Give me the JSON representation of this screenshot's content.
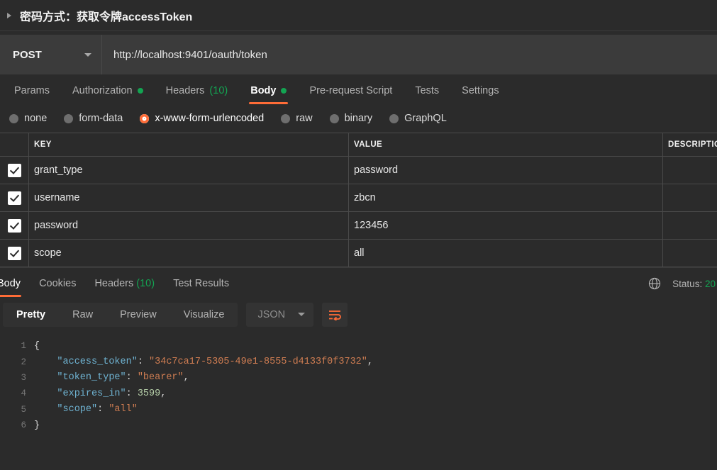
{
  "request": {
    "title": "密码方式：获取令牌accessToken",
    "method": "POST",
    "url": "http://localhost:9401/oauth/token",
    "tabs": [
      {
        "label": "Params",
        "badge": "",
        "badge_type": "none",
        "active": false
      },
      {
        "label": "Authorization",
        "badge": "",
        "badge_type": "dot",
        "active": false
      },
      {
        "label": "Headers",
        "badge": "(10)",
        "badge_type": "count",
        "active": false
      },
      {
        "label": "Body",
        "badge": "",
        "badge_type": "dot",
        "active": true
      },
      {
        "label": "Pre-request Script",
        "badge": "",
        "badge_type": "none",
        "active": false
      },
      {
        "label": "Tests",
        "badge": "",
        "badge_type": "none",
        "active": false
      },
      {
        "label": "Settings",
        "badge": "",
        "badge_type": "none",
        "active": false
      }
    ],
    "body_types": [
      {
        "label": "none",
        "selected": false
      },
      {
        "label": "form-data",
        "selected": false
      },
      {
        "label": "x-www-form-urlencoded",
        "selected": true
      },
      {
        "label": "raw",
        "selected": false
      },
      {
        "label": "binary",
        "selected": false
      },
      {
        "label": "GraphQL",
        "selected": false
      }
    ],
    "table": {
      "columns": [
        "KEY",
        "VALUE",
        "DESCRIPTION"
      ],
      "rows": [
        {
          "checked": true,
          "key": "grant_type",
          "value": "password",
          "description": ""
        },
        {
          "checked": true,
          "key": "username",
          "value": "zbcn",
          "description": ""
        },
        {
          "checked": true,
          "key": "password",
          "value": "123456",
          "description": ""
        },
        {
          "checked": true,
          "key": "scope",
          "value": "all",
          "description": ""
        }
      ]
    }
  },
  "response": {
    "tabs": [
      {
        "label": "Body",
        "badge": "",
        "active": true
      },
      {
        "label": "Cookies",
        "badge": "",
        "active": false
      },
      {
        "label": "Headers",
        "badge": "(10)",
        "active": false
      },
      {
        "label": "Test Results",
        "badge": "",
        "active": false
      }
    ],
    "status_label": "Status:",
    "status_code": "20",
    "globe_icon": "globe-icon",
    "view_modes": [
      {
        "label": "Pretty",
        "active": true
      },
      {
        "label": "Raw",
        "active": false
      },
      {
        "label": "Preview",
        "active": false
      },
      {
        "label": "Visualize",
        "active": false
      }
    ],
    "format": "JSON",
    "wrap_icon": "word-wrap-icon",
    "code_lines": [
      {
        "num": "1",
        "indent": 0,
        "tokens": [
          {
            "t": "{",
            "c": "brace"
          }
        ]
      },
      {
        "num": "2",
        "indent": 4,
        "tokens": [
          {
            "t": "\"access_token\"",
            "c": "k"
          },
          {
            "t": ": ",
            "c": "p"
          },
          {
            "t": "\"34c7ca17-5305-49e1-8555-d4133f0f3732\"",
            "c": "s"
          },
          {
            "t": ",",
            "c": "p"
          }
        ]
      },
      {
        "num": "3",
        "indent": 4,
        "tokens": [
          {
            "t": "\"token_type\"",
            "c": "k"
          },
          {
            "t": ": ",
            "c": "p"
          },
          {
            "t": "\"bearer\"",
            "c": "s"
          },
          {
            "t": ",",
            "c": "p"
          }
        ]
      },
      {
        "num": "4",
        "indent": 4,
        "tokens": [
          {
            "t": "\"expires_in\"",
            "c": "k"
          },
          {
            "t": ": ",
            "c": "p"
          },
          {
            "t": "3599",
            "c": "n"
          },
          {
            "t": ",",
            "c": "p"
          }
        ]
      },
      {
        "num": "5",
        "indent": 4,
        "tokens": [
          {
            "t": "\"scope\"",
            "c": "k"
          },
          {
            "t": ": ",
            "c": "p"
          },
          {
            "t": "\"all\"",
            "c": "s"
          }
        ]
      },
      {
        "num": "6",
        "indent": 0,
        "tokens": [
          {
            "t": "}",
            "c": "brace"
          }
        ]
      }
    ]
  },
  "colors": {
    "accent": "#ff6c37",
    "success": "#13a452",
    "background": "#2b2b2b",
    "urlbar": "#3b3b3b"
  }
}
